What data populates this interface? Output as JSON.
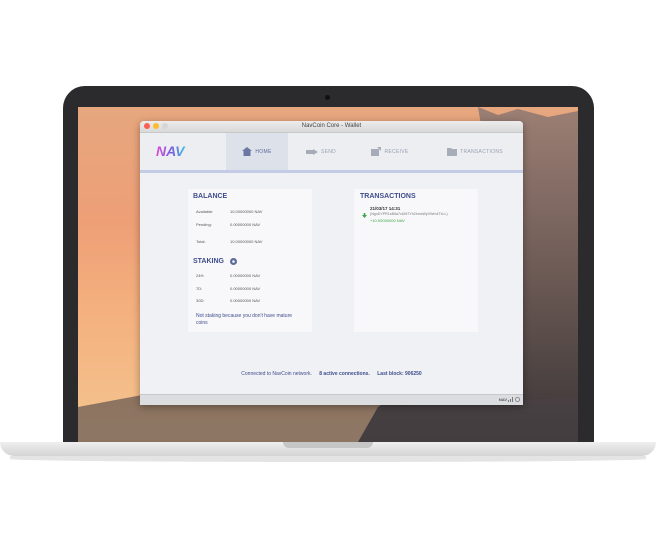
{
  "window": {
    "title": "NavCoin Core - Wallet"
  },
  "logo": {
    "text": "NAV"
  },
  "tabs": [
    {
      "label": "HOME",
      "icon": "home-icon"
    },
    {
      "label": "SEND",
      "icon": "send-icon"
    },
    {
      "label": "RECEIVE",
      "icon": "receive-icon"
    },
    {
      "label": "TRANSACTIONS",
      "icon": "folder-icon"
    }
  ],
  "balance": {
    "title": "BALANCE",
    "available_label": "Available:",
    "available": "10.00000000 NAV",
    "pending_label": "Pending:",
    "pending": "0.00000000 NAV",
    "total_label": "Total:",
    "total": "10.00000000 NAV"
  },
  "staking": {
    "title": "STAKING",
    "r24_label": "24H:",
    "r24": "0.00000000 NAV",
    "r7_label": "7D:",
    "r7": "0.00000000 NAV",
    "r30_label": "30D:",
    "r30": "0.00000000 NAV",
    "message": "Not staking because you don't have mature coins"
  },
  "transactions": {
    "title": "TRANSACTIONS",
    "items": [
      {
        "date": "21/03/17 14:31",
        "address": "(NgoDYPR1sB5a7vUM7Yh2hmxWyVWm4TxLL)",
        "amount": "+10.00000000 NAV"
      }
    ]
  },
  "status": {
    "connected": "Connected to NavCoin network.",
    "connections": "8 active connections.",
    "last_block": "Last block: 906250"
  },
  "bottom": {
    "unit": "NAV"
  },
  "colors": {
    "accent": "#3f4d8c",
    "positive": "#3aa648"
  }
}
